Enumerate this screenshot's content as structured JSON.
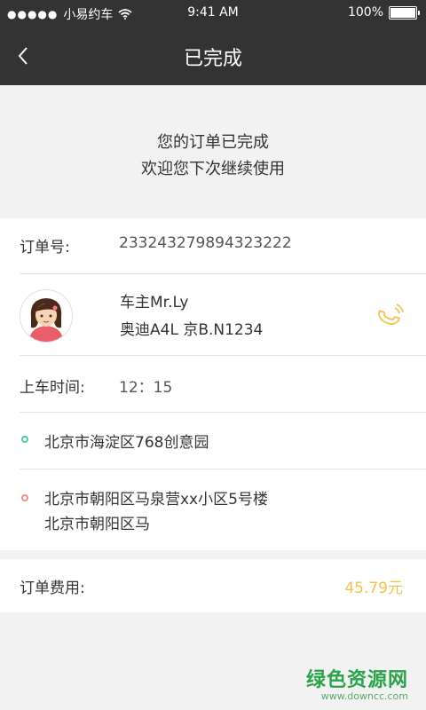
{
  "status_bar": {
    "signal_dots": "●●●●●",
    "carrier": "小易约车",
    "time": "9:41 AM",
    "battery": "100%"
  },
  "nav": {
    "title": "已完成"
  },
  "completion_message": {
    "line1": "您的订单已完成",
    "line2": "欢迎您下次继续使用"
  },
  "order": {
    "number_label": "订单号:",
    "number": "233243279894323222"
  },
  "driver": {
    "name": "车主Mr.Ly",
    "car": "奥迪A4L  京B.N1234"
  },
  "pickup_time": {
    "label": "上车时间:",
    "value": "12：15"
  },
  "addresses": {
    "start": "北京市海淀区768创意园",
    "end_line1": "北京市朝阳区马泉营xx小区5号楼",
    "end_line2": "北京市朝阳区马"
  },
  "fee": {
    "label": "订单费用:",
    "value": "45.79元"
  },
  "watermark": {
    "main": "绿色资源网",
    "sub": "www.downcc.com"
  },
  "colors": {
    "header_bg": "#333333",
    "accent_yellow": "#f2c14e",
    "start_dot": "#4ecdb4",
    "end_dot": "#f08c8c"
  }
}
